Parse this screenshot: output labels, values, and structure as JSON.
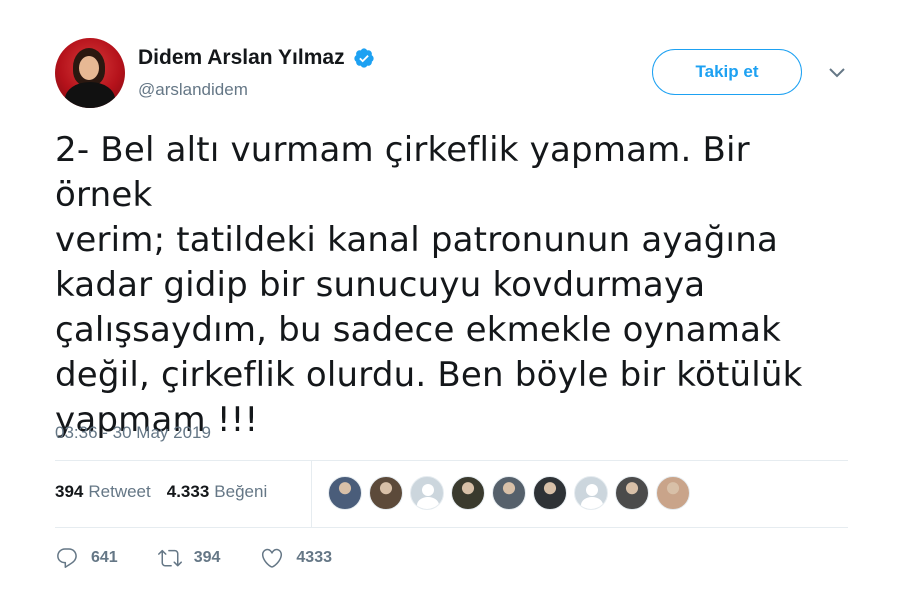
{
  "author": {
    "name": "Didem Arslan Yılmaz",
    "handle": "@arslandidem",
    "verified": true
  },
  "header": {
    "follow_label": "Takip et",
    "menu_icon": "chevron-down-icon"
  },
  "tweet": {
    "text": "2- Bel altı vurmam çirkeflik yapmam. Bir örnek\nverim; tatildeki kanal patronunun ayağına\nkadar gidip bir sunucuyu kovdurmaya\nçalışsaydım, bu sadece ekmekle oynamak\ndeğil, çirkeflik olurdu. Ben böyle bir kötülük\nyapmam !!!",
    "timestamp": "03:36 - 30 May 2019"
  },
  "stats": {
    "retweets": "394",
    "retweets_label": "Retweet",
    "likes": "4.333",
    "likes_label": "Beğeni"
  },
  "likers": [
    {
      "type": "photo",
      "color": "#4a5d7a"
    },
    {
      "type": "photo",
      "color": "#5c4a3a"
    },
    {
      "type": "default"
    },
    {
      "type": "photo",
      "color": "#3a3a2e"
    },
    {
      "type": "photo",
      "color": "#55606b"
    },
    {
      "type": "photo",
      "color": "#2e3236"
    },
    {
      "type": "default"
    },
    {
      "type": "photo",
      "color": "#4b4b4b"
    },
    {
      "type": "photo",
      "color": "#c9a48a"
    }
  ],
  "actions": {
    "reply_count": "641",
    "retweet_count": "394",
    "like_count": "4333"
  },
  "colors": {
    "accent": "#1da1f2",
    "secondary_text": "#657786",
    "divider": "#e6ecf0"
  }
}
